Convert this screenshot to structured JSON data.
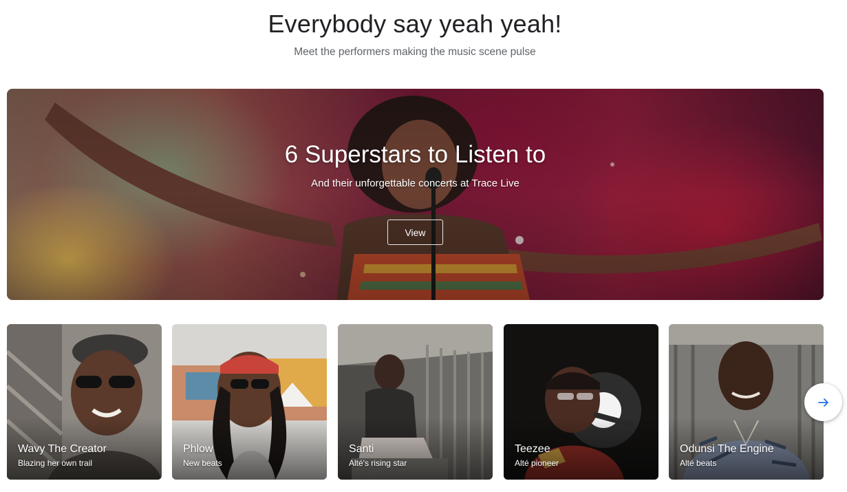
{
  "header": {
    "title": "Everybody say yeah yeah!",
    "subtitle": "Meet the performers making the music scene pulse"
  },
  "hero": {
    "title": "6 Superstars to Listen to",
    "subtitle": "And their unforgettable concerts at Trace Live",
    "button_label": "View"
  },
  "cards": [
    {
      "name": "Wavy The Creator",
      "description": "Blazing her own trail"
    },
    {
      "name": "Phlow",
      "description": "New beats"
    },
    {
      "name": "Santi",
      "description": "Alté's rising star"
    },
    {
      "name": "Teezee",
      "description": "Alté pioneer"
    },
    {
      "name": "Odunsi The Engine",
      "description": "Alté beats"
    }
  ],
  "carousel": {
    "next_icon": "arrow-right-icon",
    "accent_color": "#1a73e8"
  }
}
